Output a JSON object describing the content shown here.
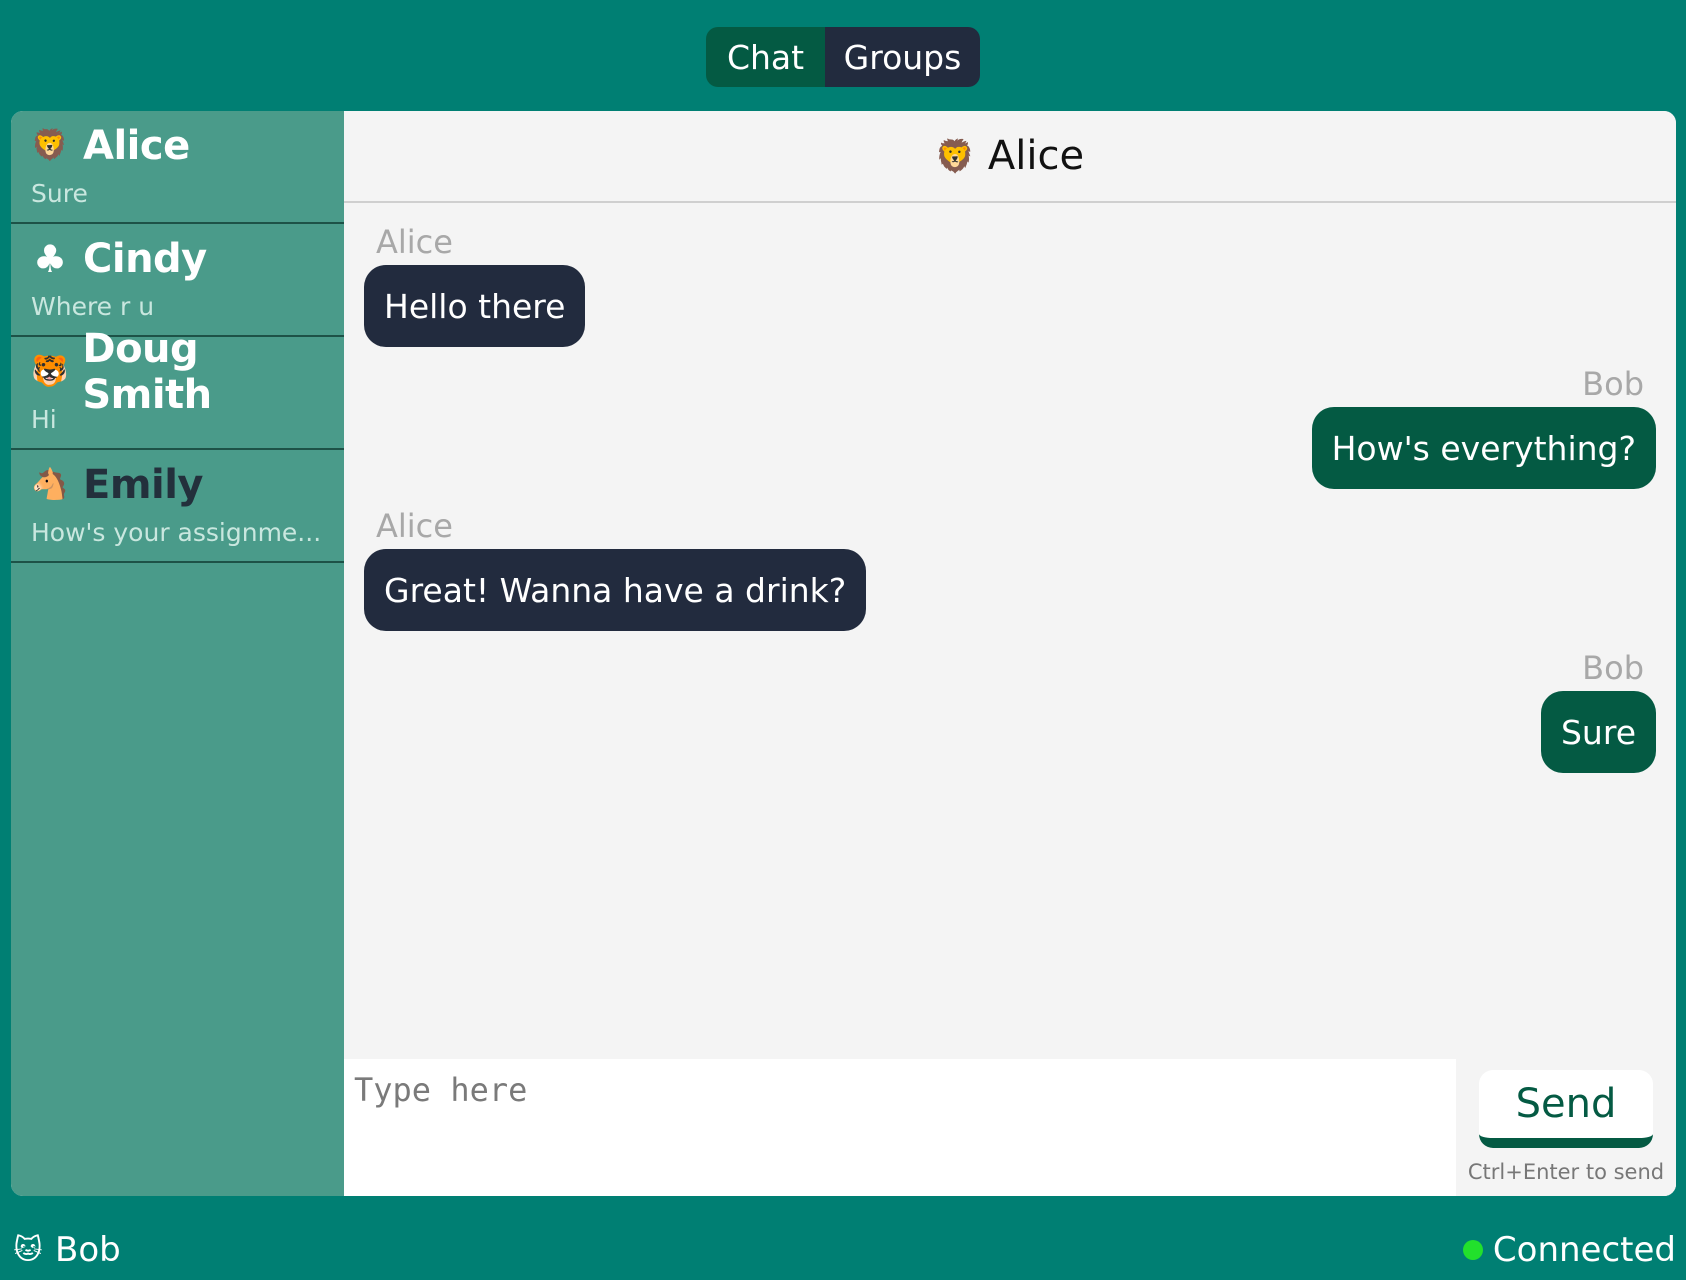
{
  "tabs": [
    {
      "label": "Chat",
      "active": true
    },
    {
      "label": "Groups",
      "active": false
    }
  ],
  "contacts": [
    {
      "icon": "lion-icon",
      "glyph": "🦁",
      "name": "Alice",
      "preview": "Sure"
    },
    {
      "icon": "club-icon",
      "glyph": "♣",
      "name": "Cindy",
      "preview": "Where r u"
    },
    {
      "icon": "tiger-icon",
      "glyph": "🐯",
      "name": "Doug Smith",
      "preview": "Hi"
    },
    {
      "icon": "horse-icon",
      "glyph": "🐴",
      "name": "Emily",
      "preview": "How's your assignme..."
    }
  ],
  "chat": {
    "title": "Alice",
    "title_icon": "lion-icon",
    "title_glyph": "🦁",
    "messages": [
      {
        "sender": "Alice",
        "text": "Hello there",
        "side": "left"
      },
      {
        "sender": "Bob",
        "text": "How's everything?",
        "side": "right"
      },
      {
        "sender": "Alice",
        "text": "Great! Wanna have a drink?",
        "side": "left"
      },
      {
        "sender": "Bob",
        "text": "Sure",
        "side": "right"
      }
    ]
  },
  "composer": {
    "placeholder": "Type here",
    "send_label": "Send",
    "hint": "Ctrl+Enter to send"
  },
  "footer": {
    "user_name": "Bob",
    "user_icon": "cat-icon",
    "user_glyph": "🐱",
    "status": "Connected"
  },
  "colors": {
    "background": "#007f73",
    "sidebar": "#4a9b8a",
    "incoming_bubble": "#222b3e",
    "outgoing_bubble": "#045a43",
    "status_online": "#22e02c"
  }
}
